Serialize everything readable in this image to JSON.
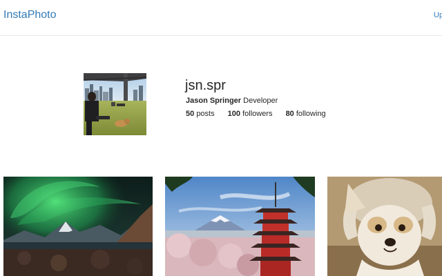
{
  "navbar": {
    "brand": "InstaPhoto",
    "upload_link": "Up"
  },
  "profile": {
    "avatar_alt": "profile photo",
    "username": "jsn.spr",
    "full_name": "Jason Springer",
    "bio": "Developer",
    "stats": [
      {
        "count": "50",
        "label": "posts"
      },
      {
        "count": "100",
        "label": "followers"
      },
      {
        "count": "80",
        "label": "following"
      }
    ]
  },
  "grid": {
    "photos": [
      {
        "subject": "aurora-over-mountains"
      },
      {
        "subject": "pagoda-and-mount-fuji"
      },
      {
        "subject": "corgi-in-hat"
      }
    ]
  },
  "colors": {
    "link": "#337ab7",
    "text": "#262626",
    "divider": "#e6e6e6"
  }
}
